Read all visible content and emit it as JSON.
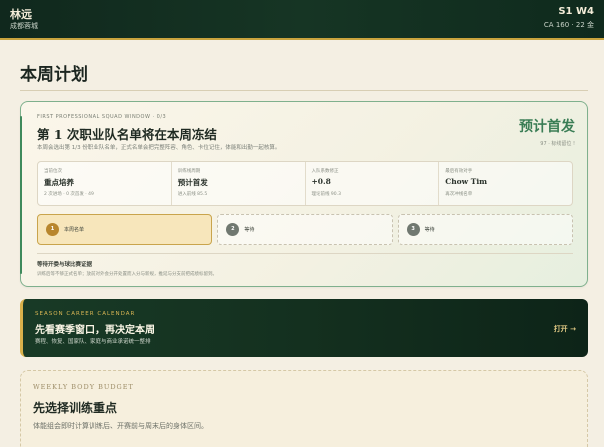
{
  "header": {
    "player_name": "林远",
    "club": "成都蓉城",
    "week": "S1 W4",
    "stats": "CA 160 · 22 金"
  },
  "page": {
    "title": "本周计划"
  },
  "squad_window": {
    "eyebrow": "FIRST PROFESSIONAL SQUAD WINDOW · 0/3",
    "headline": "第 1 次职业队名单将在本周冻结",
    "subtitle": "本周会选出第 1/3 份职业队名单，正式名单会把完整阵容、角色、卡位记住，体能和出勤一起核算。",
    "prediction": "预计首发",
    "prediction_note": "97 · 标线留位 !",
    "stats": [
      {
        "label": "当前位次",
        "value": "重点培养",
        "note": "2 次进场 · 0 次首发 · 49"
      },
      {
        "label": "训练线周期",
        "value": "预计首发",
        "note": "进入前线 85.5"
      },
      {
        "label": "入队系数修正",
        "value": "+0.8",
        "note": "理论前线 90.3"
      },
      {
        "label": "最后有效对手",
        "value": "Chow Tim",
        "note": "再次冲线名单"
      }
    ],
    "steps": [
      {
        "num": "1",
        "label": "本周名单",
        "state": "active"
      },
      {
        "num": "2",
        "label": "等待",
        "state": "pending"
      },
      {
        "num": "3",
        "label": "等待",
        "state": "pending"
      }
    ],
    "footer_title": "等待开委与球比赛证据",
    "footer_text": "训练后等不够正式名单；放前对外会分开处置而入分与新规，推延与分支前把成绩标留到。"
  },
  "calendar": {
    "eyebrow": "SEASON CAREER CALENDAR",
    "title": "先看赛季窗口，再决定本周",
    "subtitle": "赛程、恢复、国家队、家庭与商业承诺统一整排",
    "open_label": "打开 →"
  },
  "budget": {
    "eyebrow": "WEEKLY BODY BUDGET",
    "title": "先选择训练重点",
    "subtitle": "体能组会即时计算训练后、开赛前与周末后的身体区间。"
  }
}
